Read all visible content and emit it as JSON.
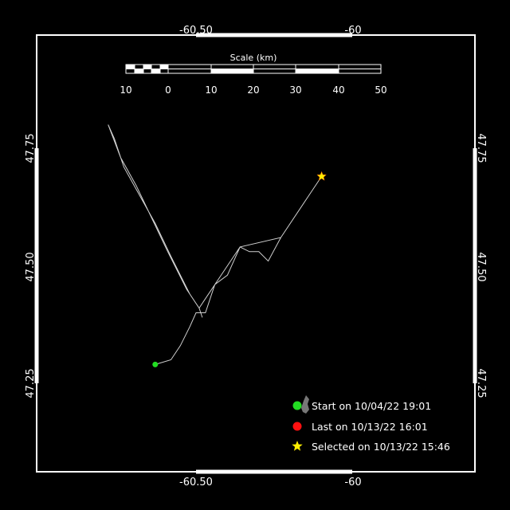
{
  "map": {
    "lon_labels": [
      "-60.50",
      "-60"
    ],
    "lat_labels": [
      "47.75",
      "47.50",
      "47.25"
    ],
    "scale": {
      "title": "Scale (km)",
      "ticks": [
        "10",
        "0",
        "10",
        "20",
        "30",
        "40",
        "50"
      ]
    },
    "legend": {
      "start": "Start on 10/04/22 19:01",
      "last": "Last on 10/13/22 16:01",
      "selected": "Selected on 10/13/22 15:46"
    },
    "colors": {
      "background": "#000000",
      "frame": "#ffffff",
      "track": "#d0d0d0",
      "start": "#22dd22",
      "last": "#ff1010",
      "selected": "#ffee00"
    },
    "track": [
      [
        -60.63,
        47.29
      ],
      [
        -60.58,
        47.3
      ],
      [
        -60.55,
        47.33
      ],
      [
        -60.52,
        47.37
      ],
      [
        -60.5,
        47.4
      ],
      [
        -60.47,
        47.4
      ],
      [
        -60.44,
        47.46
      ],
      [
        -60.4,
        47.48
      ],
      [
        -60.36,
        47.54
      ],
      [
        -60.33,
        47.53
      ],
      [
        -60.3,
        47.53
      ],
      [
        -60.27,
        47.51
      ],
      [
        -60.23,
        47.56
      ],
      [
        -60.19,
        47.6
      ],
      [
        -60.14,
        47.65
      ],
      [
        -60.1,
        47.69
      ],
      [
        -60.14,
        47.65
      ],
      [
        -60.23,
        47.56
      ],
      [
        -60.36,
        47.54
      ],
      [
        -60.44,
        47.46
      ],
      [
        -60.49,
        47.41
      ],
      [
        -60.52,
        47.44
      ],
      [
        -60.58,
        47.52
      ],
      [
        -60.63,
        47.59
      ],
      [
        -60.68,
        47.65
      ],
      [
        -60.73,
        47.71
      ],
      [
        -60.76,
        47.77
      ],
      [
        -60.78,
        47.8
      ],
      [
        -60.74,
        47.73
      ],
      [
        -60.69,
        47.67
      ],
      [
        -60.64,
        47.6
      ],
      [
        -60.59,
        47.53
      ],
      [
        -60.53,
        47.45
      ],
      [
        -60.49,
        47.41
      ],
      [
        -60.48,
        47.39
      ]
    ],
    "start_point": [
      -60.63,
      47.29
    ],
    "selected_point": [
      -60.1,
      47.69
    ]
  }
}
